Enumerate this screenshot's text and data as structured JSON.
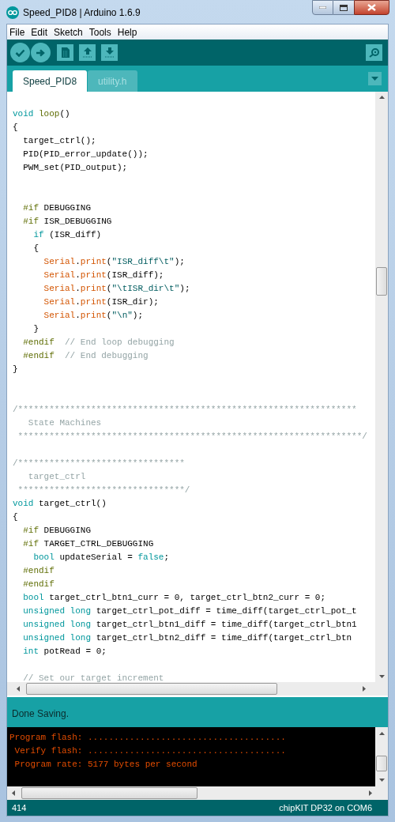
{
  "window": {
    "title": "Speed_PID8 | Arduino 1.6.9"
  },
  "menu": [
    "File",
    "Edit",
    "Sketch",
    "Tools",
    "Help"
  ],
  "tabs": [
    {
      "label": "Speed_PID8",
      "selected": true
    },
    {
      "label": "utility.h",
      "selected": false
    }
  ],
  "editor": {
    "lines": [
      {
        "kind": "code",
        "tokens": [
          {
            "text": "void",
            "kind": "keyword"
          },
          {
            "text": " loop",
            "kind": "structure"
          },
          {
            "text": "()",
            "kind": "plain"
          }
        ]
      },
      {
        "kind": "code",
        "tokens": [
          {
            "text": "{",
            "kind": "plain"
          }
        ]
      },
      {
        "kind": "code",
        "tokens": [
          {
            "text": "  target_ctrl();",
            "kind": "plain"
          }
        ]
      },
      {
        "kind": "code",
        "tokens": [
          {
            "text": "  PID(PID_error_update());",
            "kind": "plain"
          }
        ]
      },
      {
        "kind": "code",
        "tokens": [
          {
            "text": "  PWM_set(PID_output);",
            "kind": "plain"
          }
        ]
      },
      {
        "kind": "blank"
      },
      {
        "kind": "blank"
      },
      {
        "kind": "code",
        "tokens": [
          {
            "text": "  #if",
            "kind": "preprocessor"
          },
          {
            "text": " DEBUGGING",
            "kind": "plain"
          }
        ]
      },
      {
        "kind": "code",
        "tokens": [
          {
            "text": "  #if",
            "kind": "preprocessor"
          },
          {
            "text": " ISR_DEBUGGING",
            "kind": "plain"
          }
        ]
      },
      {
        "kind": "code",
        "tokens": [
          {
            "text": "    if",
            "kind": "keyword"
          },
          {
            "text": " (ISR_diff)",
            "kind": "plain"
          }
        ]
      },
      {
        "kind": "code",
        "tokens": [
          {
            "text": "    {",
            "kind": "plain"
          }
        ]
      },
      {
        "kind": "code",
        "tokens": [
          {
            "text": "      Serial",
            "kind": "function"
          },
          {
            "text": ".",
            "kind": "plain"
          },
          {
            "text": "print",
            "kind": "function"
          },
          {
            "text": "(",
            "kind": "plain"
          },
          {
            "text": "\"ISR_diff\\t\"",
            "kind": "string"
          },
          {
            "text": ");",
            "kind": "plain"
          }
        ]
      },
      {
        "kind": "code",
        "tokens": [
          {
            "text": "      Serial",
            "kind": "function"
          },
          {
            "text": ".",
            "kind": "plain"
          },
          {
            "text": "print",
            "kind": "function"
          },
          {
            "text": "(ISR_diff);",
            "kind": "plain"
          }
        ]
      },
      {
        "kind": "code",
        "tokens": [
          {
            "text": "      Serial",
            "kind": "function"
          },
          {
            "text": ".",
            "kind": "plain"
          },
          {
            "text": "print",
            "kind": "function"
          },
          {
            "text": "(",
            "kind": "plain"
          },
          {
            "text": "\"\\tISR_dir\\t\"",
            "kind": "string"
          },
          {
            "text": ");",
            "kind": "plain"
          }
        ]
      },
      {
        "kind": "code",
        "tokens": [
          {
            "text": "      Serial",
            "kind": "function"
          },
          {
            "text": ".",
            "kind": "plain"
          },
          {
            "text": "print",
            "kind": "function"
          },
          {
            "text": "(ISR_dir);",
            "kind": "plain"
          }
        ]
      },
      {
        "kind": "code",
        "tokens": [
          {
            "text": "      Serial",
            "kind": "function"
          },
          {
            "text": ".",
            "kind": "plain"
          },
          {
            "text": "print",
            "kind": "function"
          },
          {
            "text": "(",
            "kind": "plain"
          },
          {
            "text": "\"\\n\"",
            "kind": "string"
          },
          {
            "text": ");",
            "kind": "plain"
          }
        ]
      },
      {
        "kind": "code",
        "tokens": [
          {
            "text": "    }",
            "kind": "plain"
          }
        ]
      },
      {
        "kind": "code",
        "tokens": [
          {
            "text": "  #endif",
            "kind": "preprocessor"
          },
          {
            "text": "  // End loop debugging",
            "kind": "comment"
          }
        ]
      },
      {
        "kind": "code",
        "tokens": [
          {
            "text": "  #endif",
            "kind": "preprocessor"
          },
          {
            "text": "  // End debugging",
            "kind": "comment"
          }
        ]
      },
      {
        "kind": "code",
        "tokens": [
          {
            "text": "}",
            "kind": "plain"
          }
        ]
      },
      {
        "kind": "blank"
      },
      {
        "kind": "blank"
      },
      {
        "kind": "code",
        "tokens": [
          {
            "text": "/*****************************************************************",
            "kind": "comment"
          }
        ]
      },
      {
        "kind": "code",
        "tokens": [
          {
            "text": "   State Machines",
            "kind": "comment"
          }
        ]
      },
      {
        "kind": "code",
        "tokens": [
          {
            "text": " ******************************************************************/",
            "kind": "comment"
          }
        ]
      },
      {
        "kind": "blank"
      },
      {
        "kind": "code",
        "tokens": [
          {
            "text": "/********************************",
            "kind": "comment"
          }
        ]
      },
      {
        "kind": "code",
        "tokens": [
          {
            "text": "   target_ctrl",
            "kind": "comment"
          }
        ]
      },
      {
        "kind": "code",
        "tokens": [
          {
            "text": " ********************************/",
            "kind": "comment"
          }
        ]
      },
      {
        "kind": "code",
        "tokens": [
          {
            "text": "void",
            "kind": "keyword"
          },
          {
            "text": " target_ctrl()",
            "kind": "plain"
          }
        ]
      },
      {
        "kind": "code",
        "tokens": [
          {
            "text": "{",
            "kind": "plain"
          }
        ]
      },
      {
        "kind": "code",
        "tokens": [
          {
            "text": "  #if",
            "kind": "preprocessor"
          },
          {
            "text": " DEBUGGING",
            "kind": "plain"
          }
        ]
      },
      {
        "kind": "code",
        "tokens": [
          {
            "text": "  #if",
            "kind": "preprocessor"
          },
          {
            "text": " TARGET_CTRL_DEBUGGING",
            "kind": "plain"
          }
        ]
      },
      {
        "kind": "code",
        "tokens": [
          {
            "text": "    bool",
            "kind": "keyword"
          },
          {
            "text": " updateSerial = ",
            "kind": "plain"
          },
          {
            "text": "false",
            "kind": "keyword"
          },
          {
            "text": ";",
            "kind": "plain"
          }
        ]
      },
      {
        "kind": "code",
        "tokens": [
          {
            "text": "  #endif",
            "kind": "preprocessor"
          }
        ]
      },
      {
        "kind": "code",
        "tokens": [
          {
            "text": "  #endif",
            "kind": "preprocessor"
          }
        ]
      },
      {
        "kind": "code",
        "tokens": [
          {
            "text": "  bool",
            "kind": "keyword"
          },
          {
            "text": " target_ctrl_btn1_curr = 0, target_ctrl_btn2_curr = 0;",
            "kind": "plain"
          }
        ]
      },
      {
        "kind": "code",
        "tokens": [
          {
            "text": "  unsigned long",
            "kind": "keyword"
          },
          {
            "text": " target_ctrl_pot_diff = time_diff(target_ctrl_pot_t",
            "kind": "plain"
          }
        ]
      },
      {
        "kind": "code",
        "tokens": [
          {
            "text": "  unsigned long",
            "kind": "keyword"
          },
          {
            "text": " target_ctrl_btn1_diff = time_diff(target_ctrl_btn1",
            "kind": "plain"
          }
        ]
      },
      {
        "kind": "code",
        "tokens": [
          {
            "text": "  unsigned long",
            "kind": "keyword"
          },
          {
            "text": " target_ctrl_btn2_diff = time_diff(target_ctrl_btn",
            "kind": "plain"
          }
        ]
      },
      {
        "kind": "code",
        "tokens": [
          {
            "text": "  int",
            "kind": "keyword"
          },
          {
            "text": " potRead = 0;",
            "kind": "plain"
          }
        ]
      },
      {
        "kind": "blank"
      },
      {
        "kind": "code",
        "tokens": [
          {
            "text": "  // Set our target increment",
            "kind": "comment"
          }
        ]
      }
    ]
  },
  "status": {
    "message": "Done Saving."
  },
  "console": {
    "lines": [
      "Program flash: ......................................",
      " Verify flash: ......................................",
      " Program rate: 5177 bytes per second"
    ]
  },
  "footer": {
    "line": "414",
    "board": "chipKIT DP32 on COM6"
  }
}
